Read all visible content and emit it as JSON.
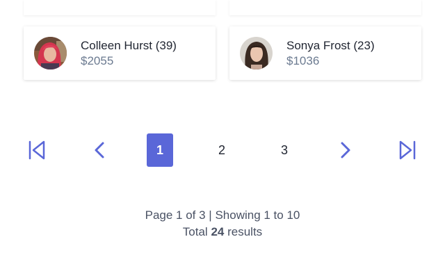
{
  "users": [
    {
      "name": "Colleen Hurst (39)",
      "amount": "$2055",
      "avatar_icon": "avatar-photo-red-hair"
    },
    {
      "name": "Sonya Frost (23)",
      "amount": "$1036",
      "avatar_icon": "avatar-photo-dark-hair"
    }
  ],
  "pagination": {
    "first_icon": "first-page-icon",
    "prev_icon": "chevron-left-icon",
    "next_icon": "chevron-right-icon",
    "last_icon": "last-page-icon",
    "pages": [
      "1",
      "2",
      "3"
    ],
    "current_page": "1",
    "accent_color": "#5a67d8"
  },
  "summary": {
    "line1": "Page 1 of 3 | Showing 1 to 10",
    "total_prefix": "Total",
    "total_count": "24",
    "total_suffix": "results"
  }
}
